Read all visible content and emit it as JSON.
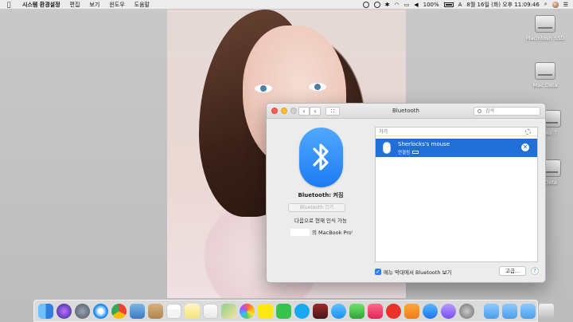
{
  "menubar": {
    "app_name": "시스템 환경설정",
    "menus": [
      "편집",
      "보기",
      "윈도우",
      "도움말"
    ],
    "battery": "100%",
    "input_source": "A",
    "datetime": "8월 16일 (화) 오후 11:09:46"
  },
  "desktop_icons": [
    "Macintosh SSD",
    "Mac Data",
    "ws 7",
    "Data"
  ],
  "window": {
    "title": "Bluetooth",
    "search_placeholder": "검색",
    "bluetooth_state": "Bluetooth: 켜짐",
    "toggle_button": "Bluetooth 끄기",
    "discoverable_text": "다음으로 현재 인식 가능",
    "device_name_suffix": "의 MacBook Pro'",
    "devices_header": "기기",
    "devices": [
      {
        "name": "Sherlocks's mouse",
        "status": "연결됨"
      }
    ],
    "show_in_menubar_label": "메뉴 막대에서 Bluetooth 보기",
    "show_in_menubar_checked": true,
    "advanced_button": "고급...",
    "help_button": "?"
  },
  "colors": {
    "selection": "#1f6fd6",
    "bluetooth_blue": "#1d7cf2"
  },
  "dock_apps": [
    "finder-icon",
    "siri-icon",
    "launchpad-icon",
    "safari-icon",
    "chrome-icon",
    "preview-icon",
    "notes-icon",
    "calendar-icon",
    "stickies-icon",
    "reminders-icon",
    "maps-icon",
    "photos-icon",
    "kakaotalk-icon",
    "line-icon",
    "skype-icon",
    "game-icon",
    "messages-icon",
    "facetime-icon",
    "music-icon",
    "podcast-icon",
    "ibooks-icon",
    "appstore-icon",
    "support-icon",
    "system-preferences-icon",
    "downloads-icon",
    "documents-icon",
    "folder-icon",
    "trash-icon"
  ]
}
